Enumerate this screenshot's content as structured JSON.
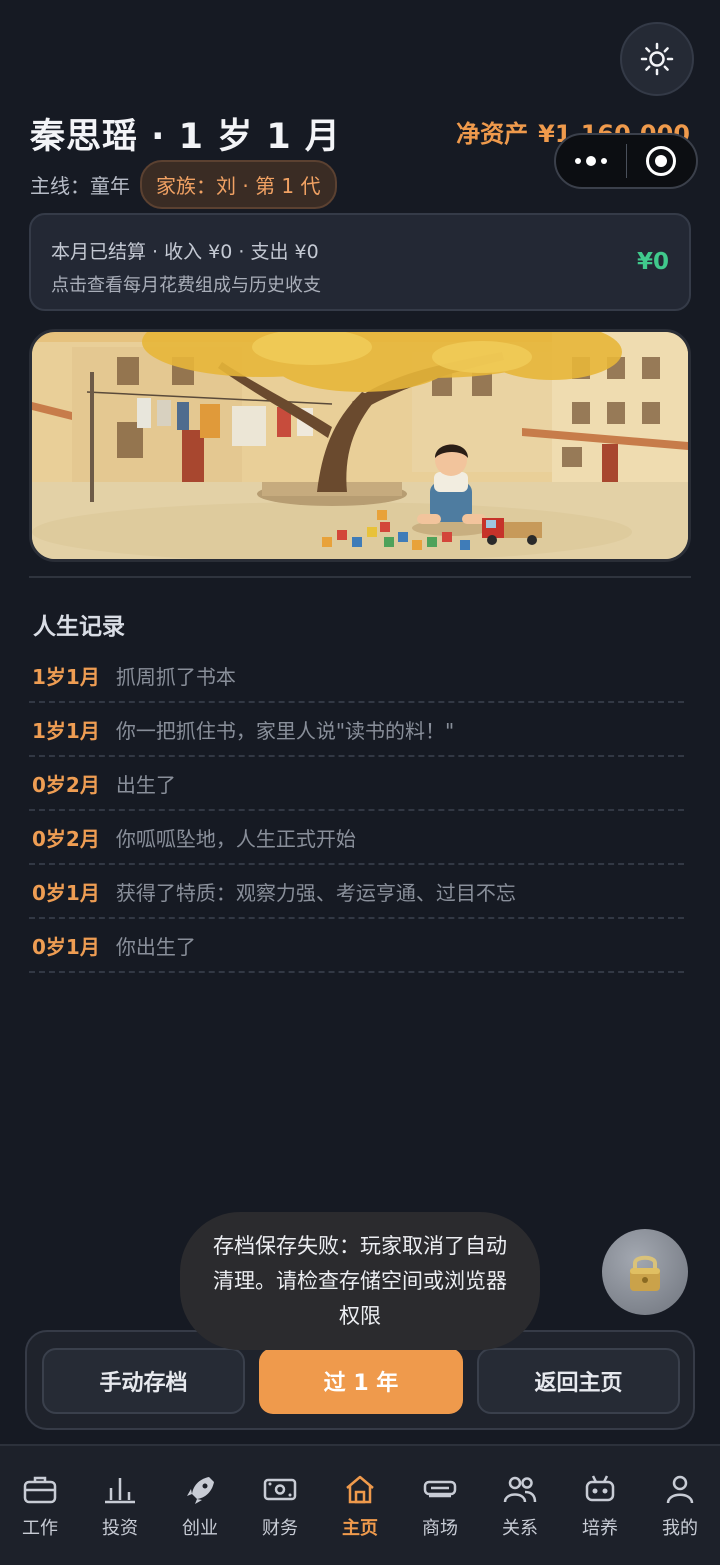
{
  "header": {
    "title": "秦思瑶 · 1 岁 1 月",
    "networth_label": "净资产",
    "networth_value": "¥1,160,000",
    "mainline": "主线：童年",
    "family_tag": "家族：刘 · 第 1 代"
  },
  "settlement": {
    "line1": "本月已结算 · 收入 ¥0 · 支出 ¥0",
    "line2": "点击查看每月花费组成与历史收支",
    "amount": "¥0",
    "amount_color": "#40c98c"
  },
  "records": {
    "title": "人生记录",
    "items": [
      {
        "age": "1岁1月",
        "text": "抓周抓了书本"
      },
      {
        "age": "1岁1月",
        "text": "你一把抓住书，家里人说\"读书的料！\""
      },
      {
        "age": "0岁2月",
        "text": "出生了"
      },
      {
        "age": "0岁2月",
        "text": "你呱呱坠地，人生正式开始"
      },
      {
        "age": "0岁1月",
        "text": "获得了特质：观察力强、考运亨通、过目不忘"
      },
      {
        "age": "0岁1月",
        "text": "你出生了"
      }
    ]
  },
  "toast": "存档保存失败：玩家取消了自动清理。请检查存储空间或浏览器权限",
  "actions": {
    "save": "手动存档",
    "next_year": "过 1 年",
    "home": "返回主页"
  },
  "nav": [
    {
      "label": "工作",
      "icon": "briefcase-icon"
    },
    {
      "label": "投资",
      "icon": "bar-chart-icon"
    },
    {
      "label": "创业",
      "icon": "rocket-icon"
    },
    {
      "label": "财务",
      "icon": "cash-icon"
    },
    {
      "label": "主页",
      "icon": "home-icon",
      "active": true
    },
    {
      "label": "商场",
      "icon": "shop-icon"
    },
    {
      "label": "关系",
      "icon": "people-icon"
    },
    {
      "label": "培养",
      "icon": "robot-icon"
    },
    {
      "label": "我的",
      "icon": "user-icon"
    }
  ],
  "colors": {
    "accent": "#ef9a4c",
    "positive": "#40c98c",
    "background": "#161a23"
  }
}
